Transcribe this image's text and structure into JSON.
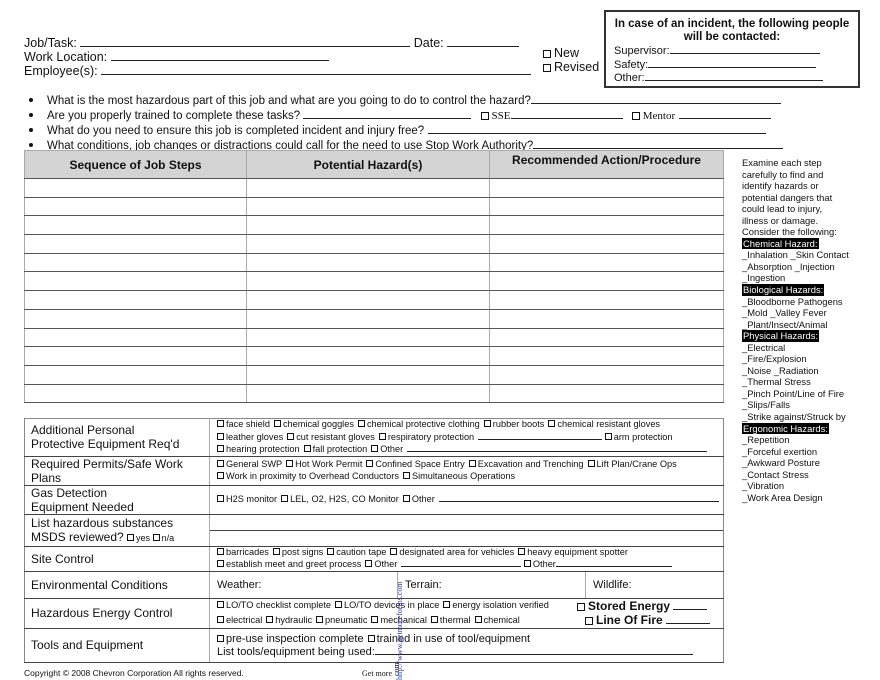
{
  "header": {
    "job_task_label": "Job/Task:",
    "date_label": "Date:",
    "work_location_label": "Work Location:",
    "employees_label": "Employee(s):",
    "status_options": [
      "New",
      "Revised"
    ]
  },
  "contact_box": {
    "title_line1": "In case of an incident, the following people",
    "title_line2": "will be contacted:",
    "supervisor_label": "Supervisor:",
    "safety_label": "Safety:",
    "other_label": "Other:"
  },
  "questions": [
    "What is the most hazardous part of this job and what are you going to do to control the hazard?",
    "Are you properly trained to complete these tasks?",
    "What do you need to ensure this job is completed incident and injury free?",
    "What conditions, job changes or distractions could call for the need to use Stop Work Authority?"
  ],
  "training_options": [
    "SSE",
    "Mentor"
  ],
  "steps_table": {
    "columns": [
      "Sequence of Job Steps",
      "Potential Hazard(s)",
      "Recommended Action/Procedure"
    ],
    "row_count": 12
  },
  "sidebar": {
    "intro": [
      "Examine each step",
      "carefully to find and",
      "identify hazards or",
      "potential dangers that",
      "could lead to injury,",
      "illness or damage.",
      "Consider the following:"
    ],
    "groups": [
      {
        "heading": "Chemical Hazard:",
        "items": [
          "_Inhalation _Skin Contact",
          "_Absorption _Injection",
          "_Ingestion"
        ]
      },
      {
        "heading": "Biological Hazards:",
        "items": [
          "_Bloodborne Pathogens",
          "_Mold _Valley Fever",
          "_Plant/Insect/Animal"
        ]
      },
      {
        "heading": "Physical Hazards:",
        "items": [
          "_Electrical",
          "_Fire/Explosion",
          "_Noise _Radiation",
          "_Thermal Stress",
          "_Pinch Point/Line of Fire",
          "_Slips/Falls",
          "_Strike against/Struck by"
        ]
      },
      {
        "heading": "Ergonomic Hazards:",
        "items": [
          "_Repetition",
          "_Forceful exertion",
          "_Awkward Posture",
          "_Contact Stress",
          "_Vibration",
          "_Work Area Design"
        ]
      }
    ]
  },
  "controls": {
    "ppe": {
      "label_line1": "Additional Personal",
      "label_line2": "Protective Equipment Req'd",
      "row1": [
        "face shield",
        "chemical goggles",
        "chemical protective clothing",
        "rubber boots",
        "chemical resistant gloves"
      ],
      "row2": [
        "leather gloves",
        "cut resistant gloves",
        "respiratory protection"
      ],
      "row2_end": "arm protection",
      "row3": [
        "hearing protection",
        "fall protection",
        "Other"
      ]
    },
    "permits": {
      "label_line1": "Required Permits/Safe Work",
      "label_line2": "Plans",
      "row1": [
        "General SWP",
        "Hot Work Permit",
        "Confined Space Entry",
        "Excavation and Trenching",
        "Lift Plan/Crane Ops"
      ],
      "row2": [
        "Work in proximity to Overhead Conductors",
        "Simultaneous Operations"
      ]
    },
    "gas": {
      "label_line1": "Gas Detection",
      "label_line2": "Equipment Needed",
      "options": [
        "H2S monitor",
        "LEL, O2, H2S, CO Monitor",
        "Other"
      ]
    },
    "substances": {
      "label_line1": "List hazardous substances",
      "label_line2": "MSDS reviewed?",
      "options": [
        "yes",
        "n/a"
      ]
    },
    "site": {
      "label": "Site Control",
      "row1": [
        "barricades",
        "post signs",
        "caution tape",
        "designated area for vehicles",
        "heavy equipment spotter"
      ],
      "row2": [
        "establish meet and greet process",
        "Other"
      ],
      "row2_end": "Other"
    },
    "env": {
      "label": "Environmental Conditions",
      "fields": [
        "Weather:",
        "Terrain:",
        "Wildlife:"
      ]
    },
    "energy": {
      "label": "Hazardous Energy Control",
      "row1": [
        "LO/TO checklist complete",
        "LO/TO devices in place",
        "energy isolation verified"
      ],
      "row2": [
        "electrical",
        "hydraulic",
        "pneumatic",
        "mechanical",
        "thermal",
        "chemical"
      ],
      "big": [
        "Stored Energy",
        "Line Of Fire"
      ]
    },
    "tools": {
      "label": "Tools and Equipment",
      "options": [
        "pre-use inspection complete",
        "trained in use of tool/equipment"
      ],
      "list_label": "List tools/equipment being used:"
    }
  },
  "footer": {
    "copyright": "Copyright © 2008 Chevron Corporation All rights reserved.",
    "get_more": "Get more",
    "watermark": "http://www.getmoreforms.com",
    "watermark_suffix": "com"
  }
}
